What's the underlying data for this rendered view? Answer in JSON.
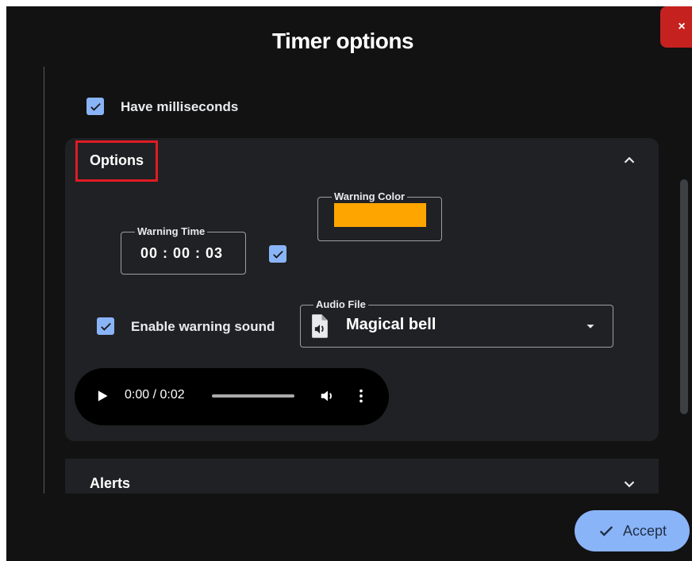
{
  "dialog": {
    "title": "Timer options",
    "close_label": "×"
  },
  "settings": {
    "have_milliseconds": {
      "label": "Have milliseconds",
      "checked": true
    }
  },
  "options_section": {
    "title": "Options",
    "expanded": true,
    "warning_time": {
      "legend": "Warning Time",
      "value": "00 : 00 : 03",
      "enabled": true
    },
    "warning_color": {
      "legend": "Warning Color",
      "value": "#ffa500"
    },
    "warning_sound": {
      "label": "Enable warning sound",
      "checked": true
    },
    "audio_file": {
      "legend": "Audio File",
      "selected": "Magical bell"
    },
    "player": {
      "time": "0:00 / 0:02"
    }
  },
  "alerts_section": {
    "title": "Alerts",
    "expanded": false
  },
  "footer": {
    "accept_label": "Accept"
  },
  "colors": {
    "accent": "#8ab4f8",
    "close": "#c5221f",
    "highlight": "#e01b24",
    "background": "#121212",
    "panel": "#202124"
  }
}
